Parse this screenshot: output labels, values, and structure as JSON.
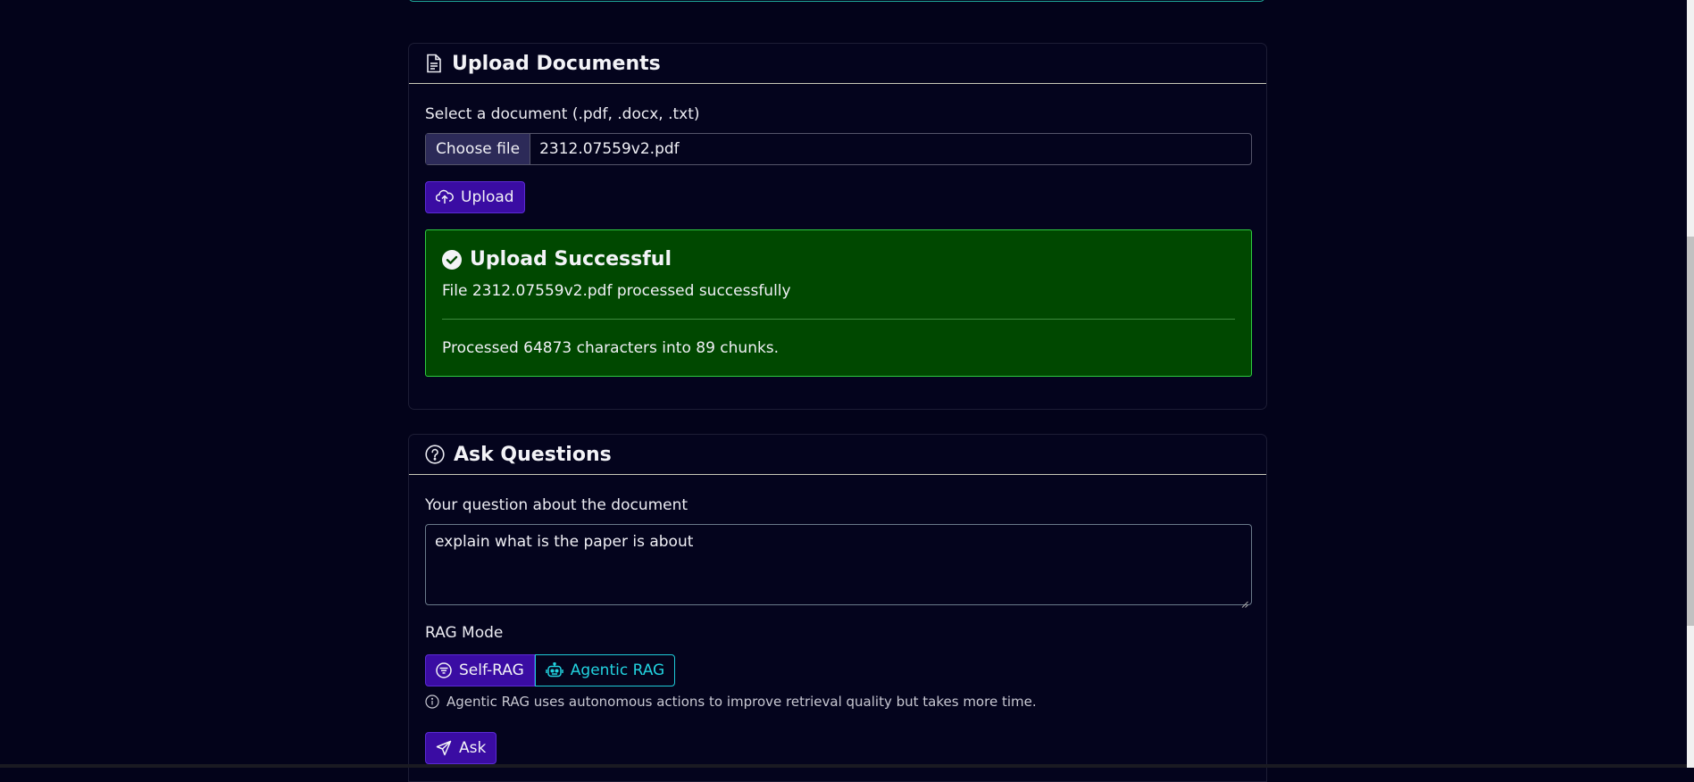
{
  "upload_section": {
    "title": "Upload Documents",
    "icon": "document-icon",
    "select_label": "Select a document (.pdf, .docx, .txt)",
    "choose_file_label": "Choose file",
    "file_name": "2312.07559v2.pdf",
    "upload_button": "Upload",
    "alert": {
      "title": "Upload Successful",
      "message": "File 2312.07559v2.pdf processed successfully",
      "detail": "Processed 64873 characters into 89 chunks.",
      "bg_color": "#004800",
      "border_color": "#2ecc40"
    }
  },
  "ask_section": {
    "title": "Ask Questions",
    "icon": "question-circle-icon",
    "question_label": "Your question about the document",
    "question_value": "explain what is the paper is about",
    "rag_mode_label": "RAG Mode",
    "modes": [
      {
        "label": "Self-RAG",
        "icon": "filter-icon",
        "selected": true
      },
      {
        "label": "Agentic RAG",
        "icon": "robot-icon",
        "selected": false
      }
    ],
    "hint": "Agentic RAG uses autonomous actions to improve retrieval quality but takes more time.",
    "ask_button": "Ask"
  },
  "colors": {
    "background": "#03031a",
    "primary": "#3a0ca3",
    "accent_cyan": "#22d3e0"
  }
}
